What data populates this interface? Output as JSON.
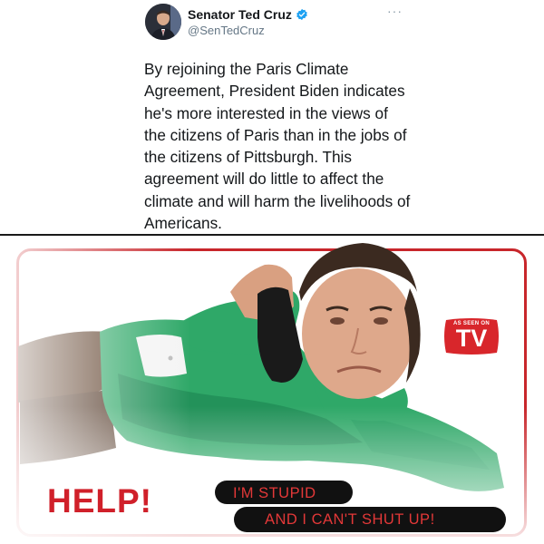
{
  "tweet": {
    "display_name": "Senator Ted Cruz",
    "handle": "@SenTedCruz",
    "more_icon": "more-options-icon",
    "verified_icon": "verified-badge-icon",
    "verified_color": "#1da1f2",
    "text_lines": [
      "By rejoining the Paris Climate",
      "Agreement, President Biden indicates",
      "he's more interested in the views of",
      "the citizens of Paris than in the jobs of",
      "the citizens of Pittsburgh. This",
      "agreement will do little to affect the",
      "climate and will harm the livelihoods of",
      "Americans."
    ]
  },
  "meme": {
    "frame_color": "#c8262b",
    "tv_badge": {
      "top_text": "AS SEEN ON",
      "big_text": "TV"
    },
    "help_text": "HELP!",
    "caption_line1": "I'M STUPID",
    "caption_line2": "AND I CAN'T SHUT UP!",
    "caption_color": "#e33838"
  }
}
